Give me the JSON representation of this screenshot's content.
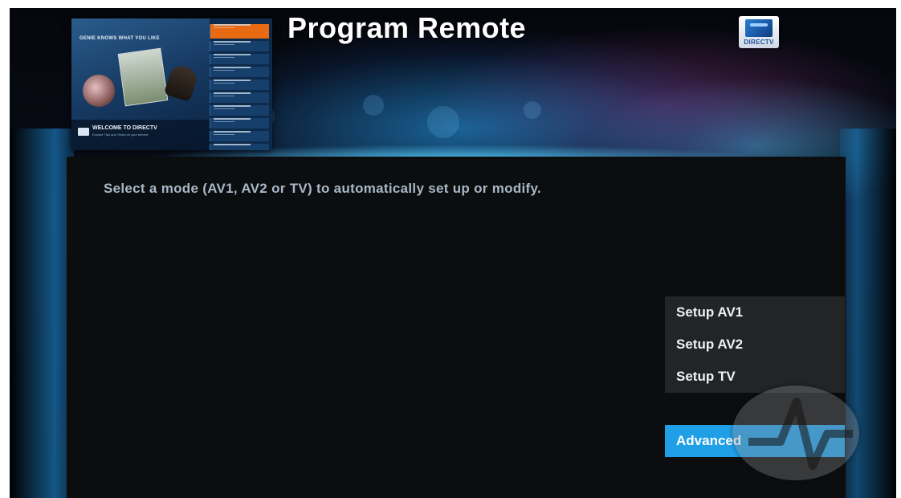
{
  "header": {
    "title": "Program Remote",
    "brand": "DIRECTV"
  },
  "preview": {
    "headline": "GENIE KNOWS WHAT YOU LIKE",
    "welcome": "WELCOME TO DIRECTV",
    "subtitle": "Explore Tips and Tricks on your service"
  },
  "main": {
    "instruction": "Select a mode (AV1, AV2 or TV) to automatically set up or modify."
  },
  "menu": {
    "items": [
      {
        "label": "Setup AV1"
      },
      {
        "label": "Setup AV2"
      },
      {
        "label": "Setup TV"
      }
    ],
    "advanced_label": "Advanced",
    "selected": "Advanced"
  },
  "colors": {
    "accent": "#1f9fe6",
    "panel": "#0c0d0e",
    "menu_bg": "#222426"
  },
  "icons": {
    "brand": "directv-logo-icon",
    "watermark": "watermark-logo-icon"
  }
}
